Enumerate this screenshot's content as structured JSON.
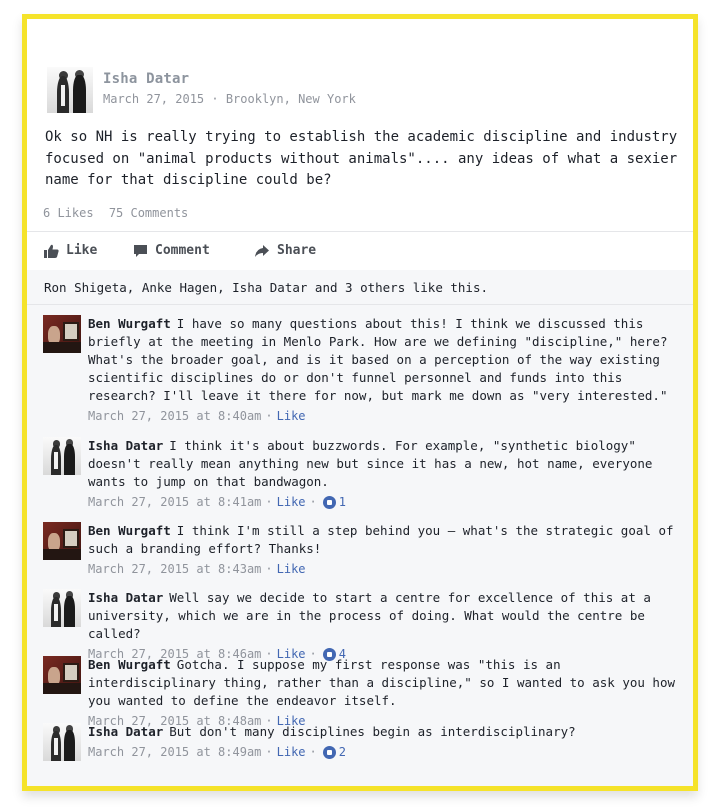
{
  "post": {
    "author": "Isha Datar",
    "meta": "March 27, 2015 · Brooklyn, New York",
    "text": "Ok so NH is really trying to establish the academic discipline and industry focused on \"animal products without animals\".... any ideas of what a sexier name for that discipline could be?",
    "likes_count": "6 Likes",
    "comments_count": "75 Comments"
  },
  "actions": {
    "like": "Like",
    "comment": "Comment",
    "share": "Share"
  },
  "likes_summary": "Ron Shigeta, Anke Hagen, Isha Datar and 3 others like this.",
  "comments": [
    {
      "author": "Ben Wurgaft",
      "text": "I have so many questions about this! I think we discussed this briefly at the meeting in Menlo Park. How are we defining \"discipline,\" here? What's the broader goal, and is it based on a perception of the way existing scientific disciplines do or don't funnel personnel and funds into this research? I'll leave it there for now, but mark me down as \"very interested.\"",
      "timestamp": "March 27, 2015 at 8:40am",
      "like_label": "Like",
      "reactions": ""
    },
    {
      "author": "Isha Datar",
      "text": "I think it's about buzzwords. For example, \"synthetic biology\" doesn't really mean anything new but since it has a new, hot name, everyone wants to jump on that bandwagon.",
      "timestamp": "March 27, 2015 at 8:41am",
      "like_label": "Like",
      "reactions": "1"
    },
    {
      "author": "Ben Wurgaft",
      "text": "I think I'm still a step behind you – what's the strategic goal of such a branding effort? Thanks!",
      "timestamp": "March 27, 2015 at 8:43am",
      "like_label": "Like",
      "reactions": ""
    },
    {
      "author": "Isha Datar",
      "text": "Well say we decide to start a centre for excellence of this at a university, which we are in the process of doing. What would the centre be called?",
      "timestamp": "March 27, 2015 at 8:46am",
      "like_label": "Like",
      "reactions": "4"
    },
    {
      "author": "Ben Wurgaft",
      "text": "Gotcha. I suppose my first response was \"this is an interdisciplinary thing, rather than a discipline,\" so I wanted to ask you how you wanted to define the endeavor itself.",
      "timestamp": "March 27, 2015 at 8:48am",
      "like_label": "Like",
      "reactions": ""
    },
    {
      "author": "Isha Datar",
      "text": "But don't many disciplines begin as interdisciplinary?",
      "timestamp": "March 27, 2015 at 8:49am",
      "like_label": "Like",
      "reactions": "2"
    }
  ],
  "colors": {
    "frame": "#f5e32a",
    "link": "#4267b2",
    "meta": "#90949c",
    "panel": "#f6f7f9"
  },
  "icons": {
    "like": "thumbs-up-icon",
    "comment": "speech-bubble-icon",
    "share": "share-arrow-icon",
    "reaction": "like-reaction-icon"
  }
}
